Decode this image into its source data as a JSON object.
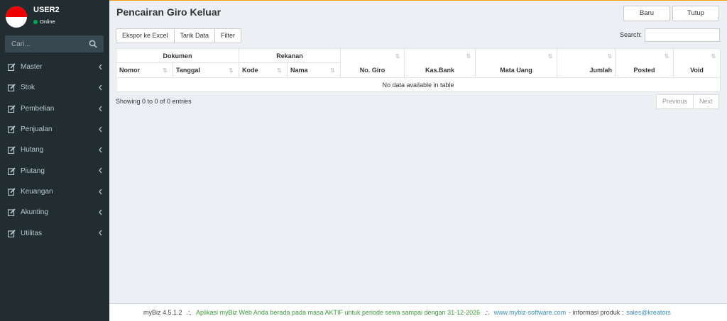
{
  "sidebar": {
    "user": {
      "name": "USER2",
      "status": "Online"
    },
    "search_placeholder": "Cari...",
    "items": [
      {
        "label": "Master"
      },
      {
        "label": "Stok"
      },
      {
        "label": "Pembelian"
      },
      {
        "label": "Penjualan"
      },
      {
        "label": "Hutang"
      },
      {
        "label": "Piutang"
      },
      {
        "label": "Keuangan"
      },
      {
        "label": "Akunting"
      },
      {
        "label": "Utilitas"
      }
    ]
  },
  "header": {
    "title": "Pencairan Giro Keluar",
    "baru_label": "Baru",
    "tutup_label": "Tutup"
  },
  "toolbar": {
    "export_label": "Ekspor ke Excel",
    "tarik_label": "Tarik Data",
    "filter_label": "Filter",
    "search_label": "Search:"
  },
  "table": {
    "group_dokumen": "Dokumen",
    "group_rekanan": "Rekanan",
    "columns": {
      "nomor": "Nomor",
      "tanggal": "Tanggal",
      "kode": "Kode",
      "nama": "Nama",
      "no_giro": "No. Giro",
      "kas_bank": "Kas.Bank",
      "mata_uang": "Mata Uang",
      "jumlah": "Jumlah",
      "posted": "Posted",
      "void": "Void"
    },
    "empty_message": "No data available in table"
  },
  "pagination": {
    "info": "Showing 0 to 0 of 0 entries",
    "previous": "Previous",
    "next": "Next"
  },
  "footer": {
    "version": "myBiz 4.5.1.2",
    "sep1": ".:.",
    "aktif": "Aplikasi myBiz Web Anda berada pada masa AKTIF untuk periode sewa sampai dengan 31-12-2026",
    "sep2": ".:.",
    "website": "www.mybiz-software.com",
    "info_label": "- informasi produk :",
    "email": "sales@kreators"
  },
  "colors": {
    "sidebar_bg": "#222d32",
    "accent_top": "#f39c12",
    "online": "#00a65a",
    "link": "#3c8dbc",
    "aktif_text": "#3c9a3c"
  }
}
